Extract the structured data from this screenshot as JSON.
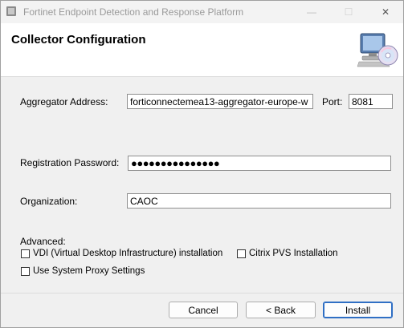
{
  "window": {
    "title": "Fortinet Endpoint Detection and Response Platform",
    "minimize_glyph": "—",
    "maximize_glyph": "☐",
    "close_glyph": "✕"
  },
  "header": {
    "title": "Collector Configuration",
    "icon": "computer-cd-icon"
  },
  "form": {
    "aggregator_label": "Aggregator Address:",
    "aggregator_value": "forticonnectemea13-aggregator-europe-w",
    "port_label": "Port:",
    "port_value": "8081",
    "registration_label": "Registration Password:",
    "registration_value": "●●●●●●●●●●●●●●●",
    "organization_label": "Organization:",
    "organization_value": "CAOC"
  },
  "advanced": {
    "label": "Advanced:",
    "vdi_label": "VDI (Virtual Desktop Infrastructure) installation",
    "vdi_checked": false,
    "citrix_label": "Citrix PVS Installation",
    "citrix_checked": false,
    "proxy_label": "Use System Proxy Settings",
    "proxy_checked": false
  },
  "buttons": {
    "cancel": "Cancel",
    "back": "< Back",
    "install": "Install"
  },
  "colors": {
    "primary_border": "#2f6fc4",
    "background": "#f0f0f0",
    "header_background": "#ffffff"
  }
}
